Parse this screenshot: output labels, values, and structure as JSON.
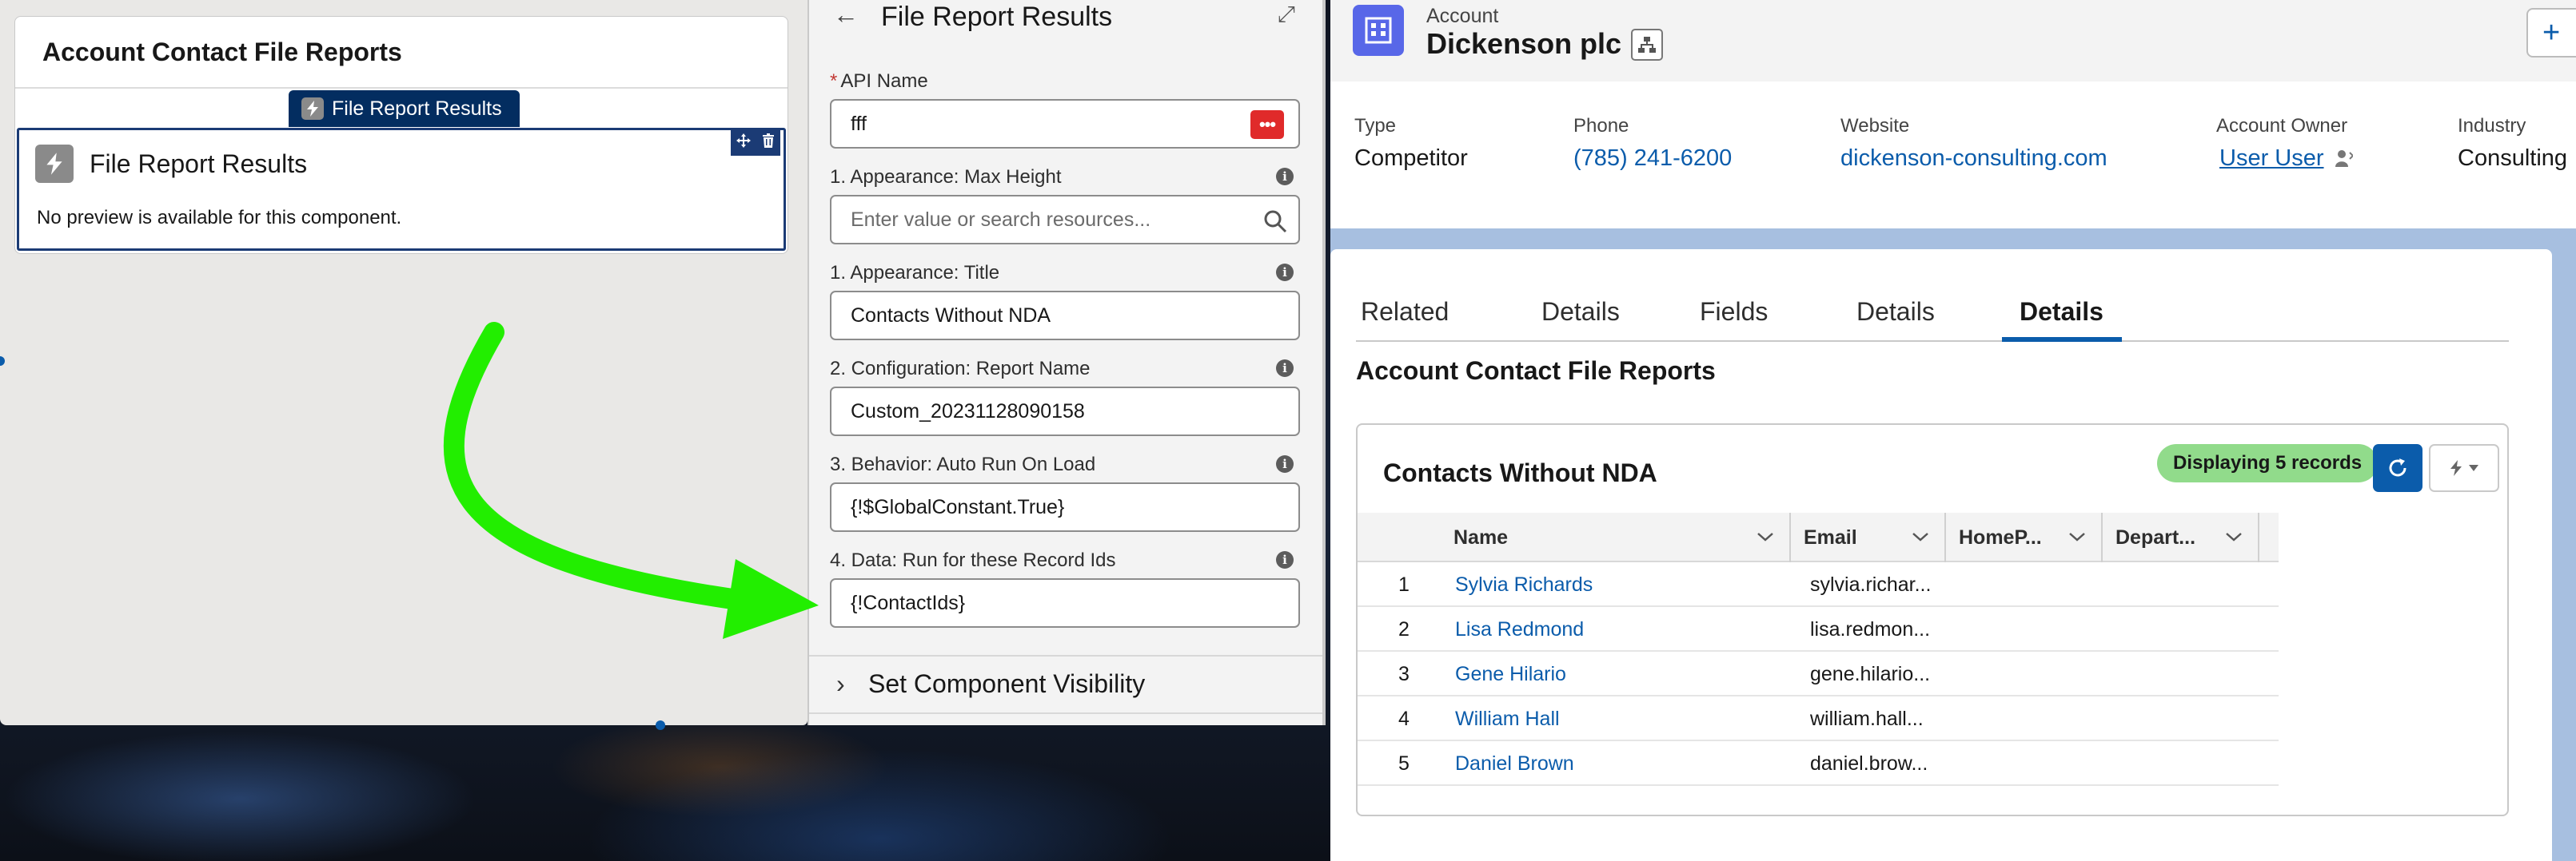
{
  "canvas": {
    "card_title": "Account Contact File Reports",
    "component_tag": "File Report Results",
    "component_title": "File Report Results",
    "no_preview": "No preview is available for this component."
  },
  "props": {
    "title": "File Report Results",
    "fields": [
      {
        "label": "API Name",
        "required": true,
        "value": "fff"
      },
      {
        "label": "1. Appearance: Max Height",
        "placeholder": "Enter value or search resources..."
      },
      {
        "label": "1. Appearance: Title",
        "value": "Contacts Without NDA"
      },
      {
        "label": "2. Configuration: Report Name",
        "value": "Custom_20231128090158"
      },
      {
        "label": "3. Behavior: Auto Run On Load",
        "value": "{!$GlobalConstant.True}"
      },
      {
        "label": "4. Data: Run for these Record Ids",
        "value": "{!ContactIds}"
      }
    ],
    "visibility_label": "Set Component Visibility"
  },
  "record": {
    "object_type": "Account",
    "name": "Dickenson plc",
    "plus_label": "+",
    "highlights": [
      {
        "label": "Type",
        "value": "Competitor"
      },
      {
        "label": "Phone",
        "value": "(785) 241-6200"
      },
      {
        "label": "Website",
        "value": "dickenson-consulting.com"
      },
      {
        "label": "Account Owner",
        "value": "User User"
      },
      {
        "label": "Industry",
        "value": "Consulting"
      }
    ],
    "tabs": [
      "Related",
      "Details",
      "Fields",
      "Details",
      "Details"
    ],
    "active_tab_index": 4,
    "section_title": "Account Contact File Reports",
    "report": {
      "title": "Contacts Without NDA",
      "badge": "Displaying 5 records",
      "columns": [
        "Name",
        "Email",
        "HomeP...",
        "Depart..."
      ],
      "rows": [
        {
          "num": "1",
          "name": "Sylvia Richards",
          "email": "sylvia.richar..."
        },
        {
          "num": "2",
          "name": "Lisa Redmond",
          "email": "lisa.redmon..."
        },
        {
          "num": "3",
          "name": "Gene Hilario",
          "email": "gene.hilario..."
        },
        {
          "num": "4",
          "name": "William Hall",
          "email": "william.hall..."
        },
        {
          "num": "5",
          "name": "Daniel Brown",
          "email": "daniel.brow..."
        }
      ]
    }
  },
  "colors": {
    "brand_blue": "#0b5cab",
    "badge_green": "#91db8b",
    "arrow_green": "#22ee00",
    "account_icon": "#5867e8"
  }
}
